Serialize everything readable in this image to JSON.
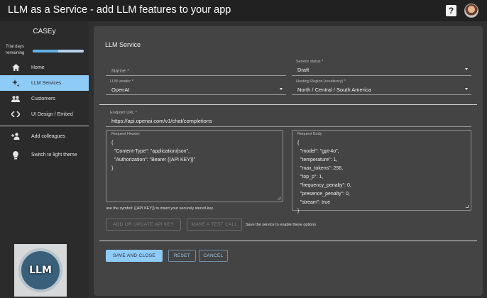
{
  "appbar": {
    "title": "LLM as a Service - add LLM features to your app",
    "help_icon": "question-mark-icon",
    "avatar": "user-avatar"
  },
  "sidebar": {
    "brand": "CASEy",
    "trial_label": "Trial days remaining",
    "trial_progress": 0.5,
    "items": [
      {
        "label": "Home",
        "icon": "home-icon"
      },
      {
        "label": "LLM Services",
        "icon": "sparkle-icon",
        "active": true
      },
      {
        "label": "Customers",
        "icon": "people-icon"
      },
      {
        "label": "UI Design / Embed",
        "icon": "code-icon"
      },
      {
        "label": "Add colleagues",
        "icon": "add-person-icon"
      },
      {
        "label": "Switch to light theme",
        "icon": "lightbulb-icon"
      }
    ],
    "badge_text": "LLM"
  },
  "form": {
    "title": "LLM Service",
    "name": {
      "placeholder": "Name *"
    },
    "status": {
      "label": "Service status *",
      "value": "Draft"
    },
    "vendor": {
      "label": "LLM vendor *",
      "value": "OpenAI"
    },
    "region": {
      "label": "Hosting Region (residency) *",
      "value": "North / Central / South America"
    },
    "endpoint": {
      "label": "Endpoint URL *",
      "value": "https://api.openai.com/v1/chat/completions"
    },
    "request_header": {
      "label": "Request Header",
      "value": "{\n  \"Content-Type\": \"application/json\",\n  \"Authorization\": \"Bearer {{API KEY}}\"\n}"
    },
    "request_body": {
      "label": "Request Body",
      "value": "{\n  \"model\": \"gpt-4o\",\n  \"temperature\": 1,\n  \"max_tokens\": 256,\n  \"top_p\": 1,\n  \"frequency_penalty\": 0,\n  \"presence_penalty\": 0,\n  \"stream\": true\n}"
    },
    "hint": "use the symbol: {{API KEY}} to insert your securely stored key.",
    "buttons": {
      "add_api_key": "ADD OR UPDATE API KEY",
      "test_call": "MAKE A TEST CALL",
      "save_note": "Save the service to enable these options",
      "save_close": "SAVE AND CLOSE",
      "reset": "RESET",
      "cancel": "CANCEL"
    }
  }
}
